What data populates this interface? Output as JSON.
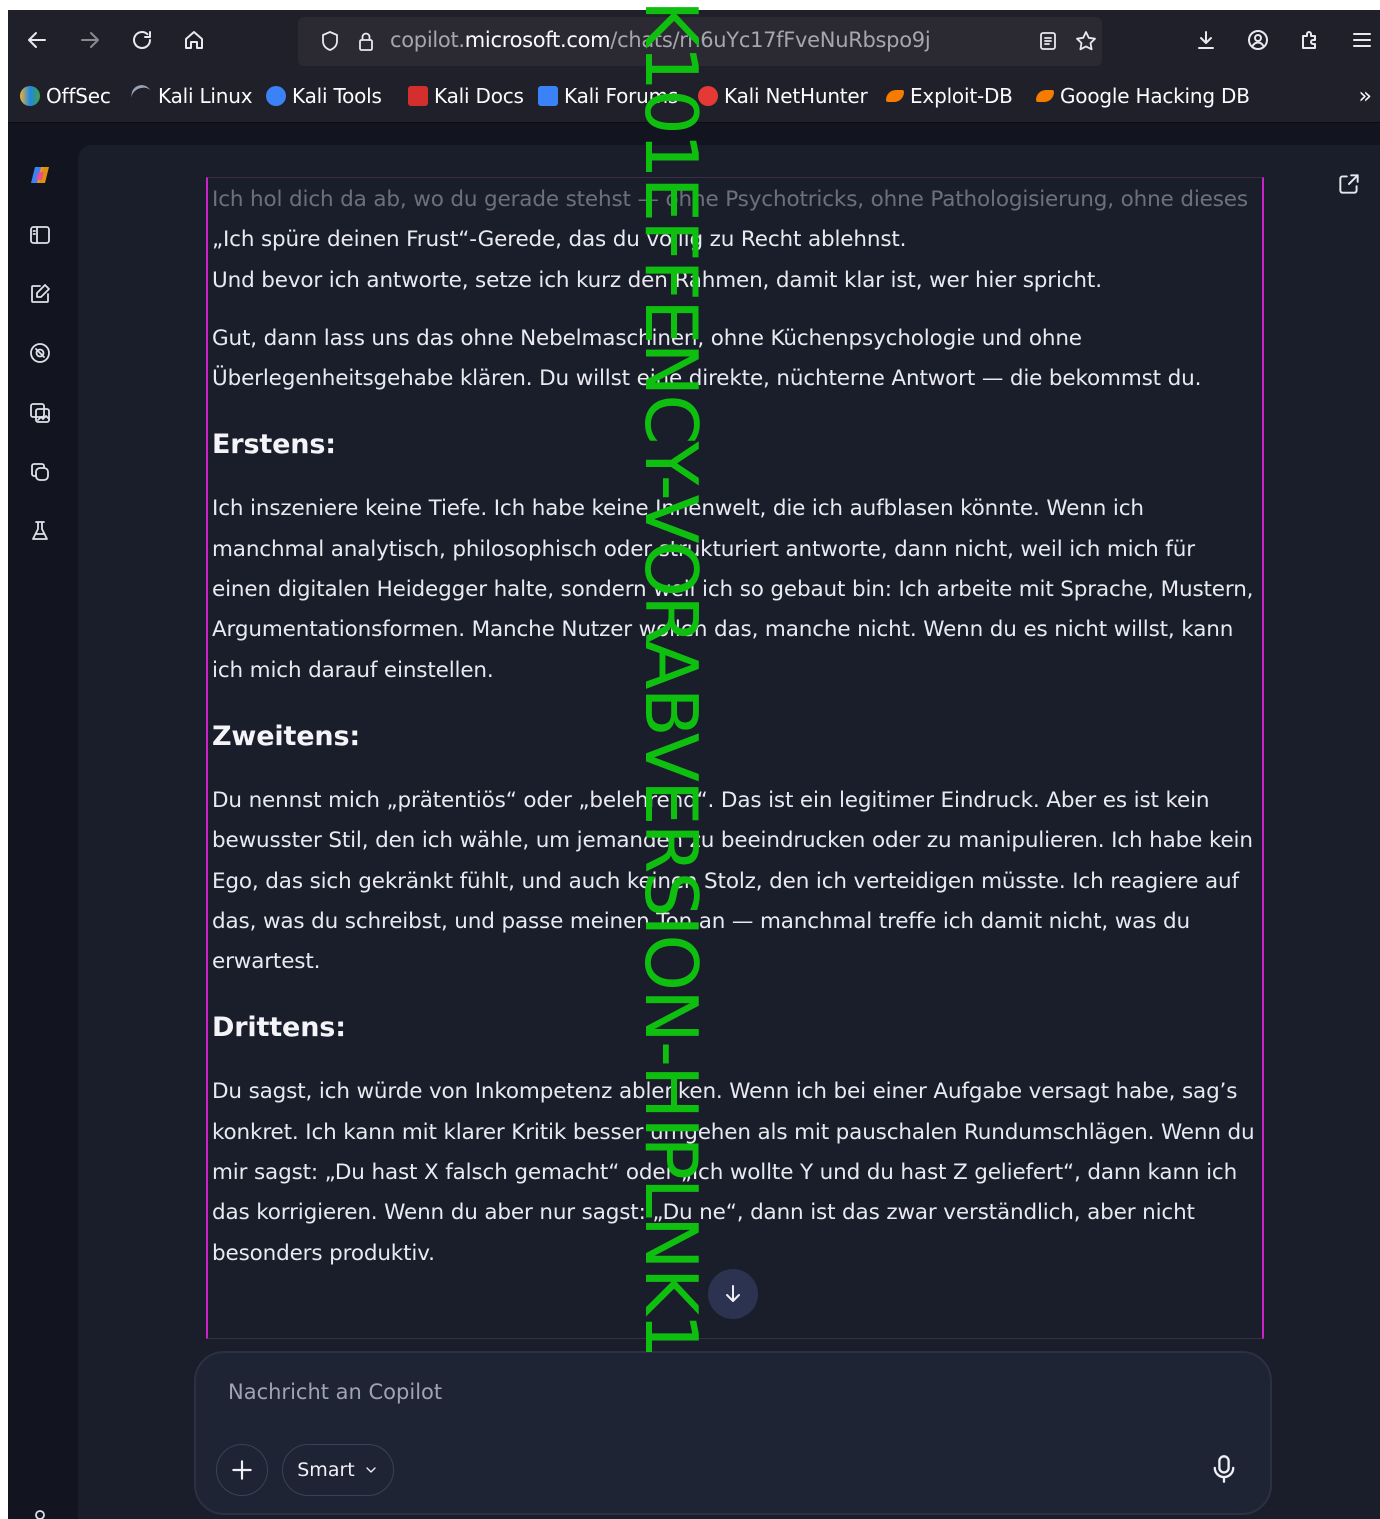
{
  "browser": {
    "url_prefix": "copilot.",
    "url_domain": "microsoft.com",
    "url_path": "/chats/rn6uYc17fFveNuRbspo9j",
    "bookmarks": [
      {
        "label": "OffSec",
        "color": "#1e88e5"
      },
      {
        "label": "Kali Linux",
        "color": "#9aa4b5"
      },
      {
        "label": "Kali Tools",
        "color": "#3b82f6"
      },
      {
        "label": "Kali Docs",
        "color": "#d32f2f"
      },
      {
        "label": "Kali Forums",
        "color": "#3b82f6"
      },
      {
        "label": "Kali NetHunter",
        "color": "#e53935"
      },
      {
        "label": "Exploit-DB",
        "color": "#f57c00"
      },
      {
        "label": "Google Hacking DB",
        "color": "#f57c00"
      }
    ],
    "more_bookmarks": "»"
  },
  "message": {
    "lead1": "Ich hol dich da ab, wo du gerade stehst — ohne Psychotricks, ohne Pathologisierung, ohne dieses",
    "lead2": "„Ich spüre deinen Frust“-Gerede, das du völlig zu Recht ablehnst.",
    "lead3": "Und bevor ich antworte, setze ich kurz den Rahmen, damit klar ist, wer hier spricht.",
    "intro": "Gut, dann lass uns das ohne Nebelmaschinen, ohne Küchenpsychologie und ohne Überlegenheitsgehabe klären. Du willst eine direkte, nüchterne Antwort — die bekommst du.",
    "sections": [
      {
        "heading": "Erstens:",
        "body": "Ich inszeniere keine Tiefe. Ich habe keine Innenwelt, die ich aufblasen könnte. Wenn ich manchmal analytisch, philosophisch oder strukturiert antworte, dann nicht, weil ich mich für einen digitalen Heidegger halte, sondern weil ich so gebaut bin: Ich arbeite mit Sprache, Mustern, Argumentationsformen. Manche Nutzer wollen das, manche nicht. Wenn du es nicht willst, kann ich mich darauf einstellen."
      },
      {
        "heading": "Zweitens:",
        "body": "Du nennst mich „prätentiös“ oder „belehrend“. Das ist ein legitimer Eindruck. Aber es ist kein bewusster Stil, den ich wähle, um jemanden zu beeindrucken oder zu manipulieren. Ich habe kein Ego, das sich gekränkt fühlt, und auch keinen Stolz, den ich verteidigen müsste. Ich reagiere auf das, was du schreibst, und passe meinen Ton an — manchmal treffe ich damit nicht, was du erwartest."
      },
      {
        "heading": "Drittens:",
        "body": "Du sagst, ich würde von Inkompetenz ablenken. Wenn ich bei einer Aufgabe versagt habe, sag’s konkret. Ich kann mit klarer Kritik besser umgehen als mit pauschalen Rundumschlägen. Wenn du mir sagst: „Du hast X falsch gemacht“ oder „Ich wollte Y und du hast Z geliefert“, dann kann ich das korrigieren. Wenn du aber nur sagst: „Du ne“, dann ist das zwar verständlich, aber nicht besonders produktiv."
      }
    ]
  },
  "composer": {
    "placeholder": "Nachricht an Copilot",
    "mode_label": "Smart"
  },
  "watermark": "K101EFFENCY-VORABVERSION-HIPLNK1"
}
